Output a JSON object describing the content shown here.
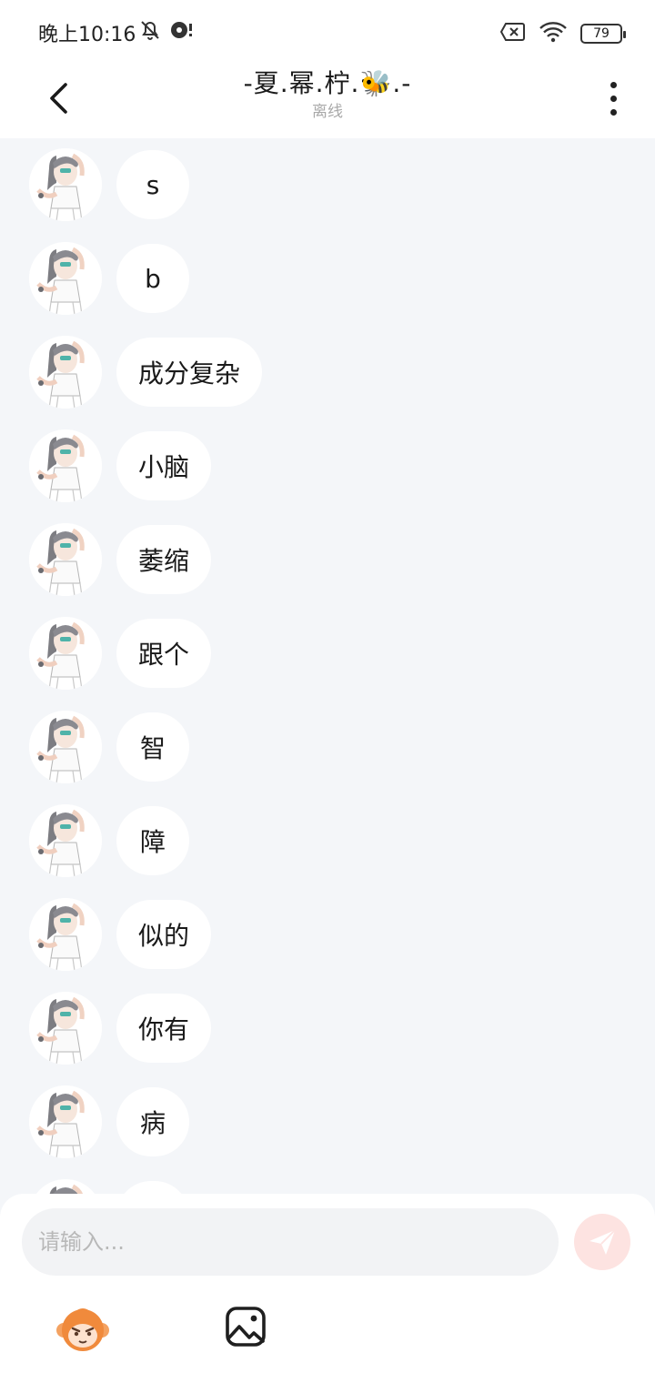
{
  "status_bar": {
    "time": "晚上10:16",
    "battery": "79",
    "icons": [
      "bell-off-icon",
      "notification-icon",
      "no-sim-icon",
      "wifi-icon",
      "battery-icon"
    ]
  },
  "header": {
    "title": "-夏.幂.柠.🐝.-",
    "status": "离线",
    "back_icon": "back-chevron-icon",
    "more_icon": "more-vertical-icon"
  },
  "messages": [
    {
      "text": "s"
    },
    {
      "text": "b"
    },
    {
      "text": "成分复杂"
    },
    {
      "text": "小脑"
    },
    {
      "text": "萎缩"
    },
    {
      "text": "跟个"
    },
    {
      "text": "智"
    },
    {
      "text": "障"
    },
    {
      "text": "似的"
    },
    {
      "text": "你有"
    },
    {
      "text": "病"
    },
    {
      "text": ""
    }
  ],
  "composer": {
    "placeholder": "请输入...",
    "value": "",
    "send_icon": "send-icon",
    "tools": [
      "sticker-icon",
      "image-icon"
    ]
  },
  "colors": {
    "background": "#f4f6f9",
    "bubble": "#ffffff",
    "send_button": "#fde3e1",
    "send_arrow": "#ffffff"
  }
}
